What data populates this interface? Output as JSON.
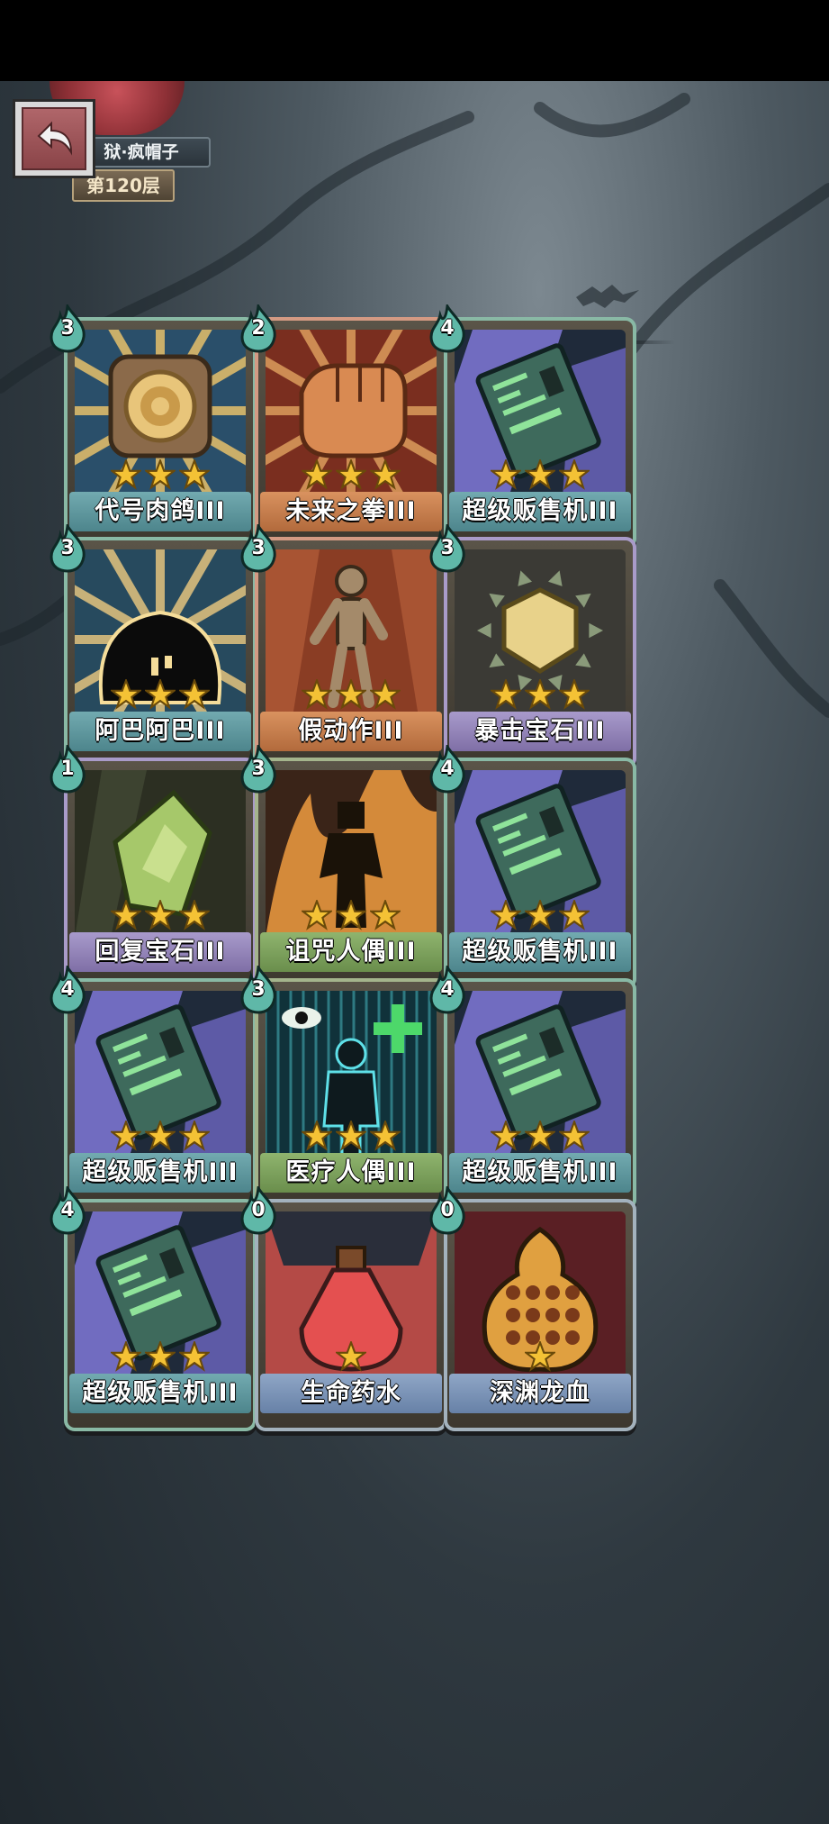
{
  "header": {
    "boss_name": "狱·疯帽子",
    "floor": "第120层"
  },
  "cards": [
    {
      "name": "代号肉鸽III",
      "cost": "3",
      "stars": 3,
      "art": "slot-machine-icon",
      "theme": "teal"
    },
    {
      "name": "未来之拳III",
      "cost": "2",
      "stars": 3,
      "art": "fist-icon",
      "theme": "orange"
    },
    {
      "name": "超级贩售机III",
      "cost": "4",
      "stars": 3,
      "art": "vending-machine-icon",
      "theme": "teal"
    },
    {
      "name": "阿巴阿巴III",
      "cost": "3",
      "stars": 3,
      "art": "blob-monster-icon",
      "theme": "teal"
    },
    {
      "name": "假动作III",
      "cost": "3",
      "stars": 3,
      "art": "mannequin-icon",
      "theme": "orange"
    },
    {
      "name": "暴击宝石III",
      "cost": "3",
      "stars": 3,
      "art": "crit-gem-icon",
      "theme": "lilac"
    },
    {
      "name": "回复宝石III",
      "cost": "1",
      "stars": 3,
      "art": "heal-gem-icon",
      "theme": "lilac"
    },
    {
      "name": "诅咒人偶III",
      "cost": "3",
      "stars": 3,
      "art": "cursed-doll-icon",
      "theme": "green"
    },
    {
      "name": "超级贩售机III",
      "cost": "4",
      "stars": 3,
      "art": "vending-machine-icon",
      "theme": "teal"
    },
    {
      "name": "超级贩售机III",
      "cost": "4",
      "stars": 3,
      "art": "vending-machine-icon",
      "theme": "teal"
    },
    {
      "name": "医疗人偶III",
      "cost": "3",
      "stars": 3,
      "art": "medical-doll-icon",
      "theme": "green"
    },
    {
      "name": "超级贩售机III",
      "cost": "4",
      "stars": 3,
      "art": "vending-machine-icon",
      "theme": "teal"
    },
    {
      "name": "超级贩售机III",
      "cost": "4",
      "stars": 3,
      "art": "vending-machine-icon",
      "theme": "teal"
    },
    {
      "name": "生命药水",
      "cost": "0",
      "stars": 1,
      "art": "health-potion-icon",
      "theme": "steel"
    },
    {
      "name": "深渊龙血",
      "cost": "0",
      "stars": 1,
      "art": "dragon-blood-icon",
      "theme": "steel"
    }
  ],
  "colors": {
    "teal": "#4d858c",
    "orange": "#b26a3c",
    "lilac": "#7f6fa6",
    "green": "#6a8e4c",
    "steel": "#6781a7",
    "star": "#f4c235"
  }
}
